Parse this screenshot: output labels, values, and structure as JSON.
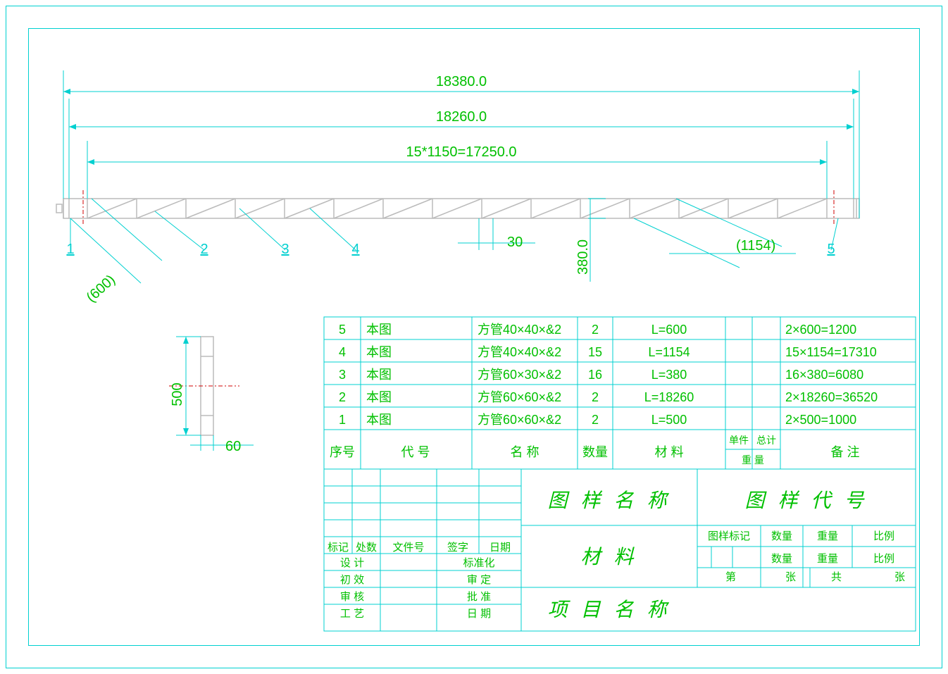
{
  "dims": {
    "overall": "18380.0",
    "inner": "18260.0",
    "span": "15*1150=17250.0",
    "gap": "30",
    "vert": "380.0",
    "diag1": "(1154)",
    "diag2": "(600)",
    "detail_h": "500",
    "detail_w": "60"
  },
  "callouts": [
    "1",
    "2",
    "3",
    "4",
    "5"
  ],
  "bom": {
    "rows": [
      {
        "n": "5",
        "code": "本图",
        "name": "方管40×40×&2",
        "qty": "2",
        "mat": "L=600",
        "note": "2×600=1200"
      },
      {
        "n": "4",
        "code": "本图",
        "name": "方管40×40×&2",
        "qty": "15",
        "mat": "L=1154",
        "note": "15×1154=17310"
      },
      {
        "n": "3",
        "code": "本图",
        "name": "方管60×30×&2",
        "qty": "16",
        "mat": "L=380",
        "note": "16×380=6080"
      },
      {
        "n": "2",
        "code": "本图",
        "name": "方管60×60×&2",
        "qty": "2",
        "mat": "L=18260",
        "note": "2×18260=36520"
      },
      {
        "n": "1",
        "code": "本图",
        "name": "方管60×60×&2",
        "qty": "2",
        "mat": "L=500",
        "note": "2×500=1000"
      }
    ],
    "hdr": {
      "n": "序号",
      "code": "代    号",
      "name": "名    称",
      "qty": "数量",
      "mat": "材    料",
      "unit": "单件",
      "total": "总计",
      "weight": "重    量",
      "note": "备    注"
    }
  },
  "title": {
    "t1": "图 样 名 称",
    "t2": "图 样 代 号",
    "t3": "材  料",
    "t4": "项 目 名 称",
    "marks": [
      "标记",
      "处数",
      "文件号",
      "签字",
      "日期"
    ],
    "rows": [
      "设  计",
      "初  效",
      "审  核",
      "工  艺",
      "标准化",
      "审  定",
      "批  准",
      "日  期"
    ],
    "cols": [
      "图样标记",
      "数量",
      "重量",
      "比例",
      "数量",
      "重量",
      "比例"
    ],
    "sheet": [
      "第",
      "张",
      "共",
      "张"
    ]
  }
}
